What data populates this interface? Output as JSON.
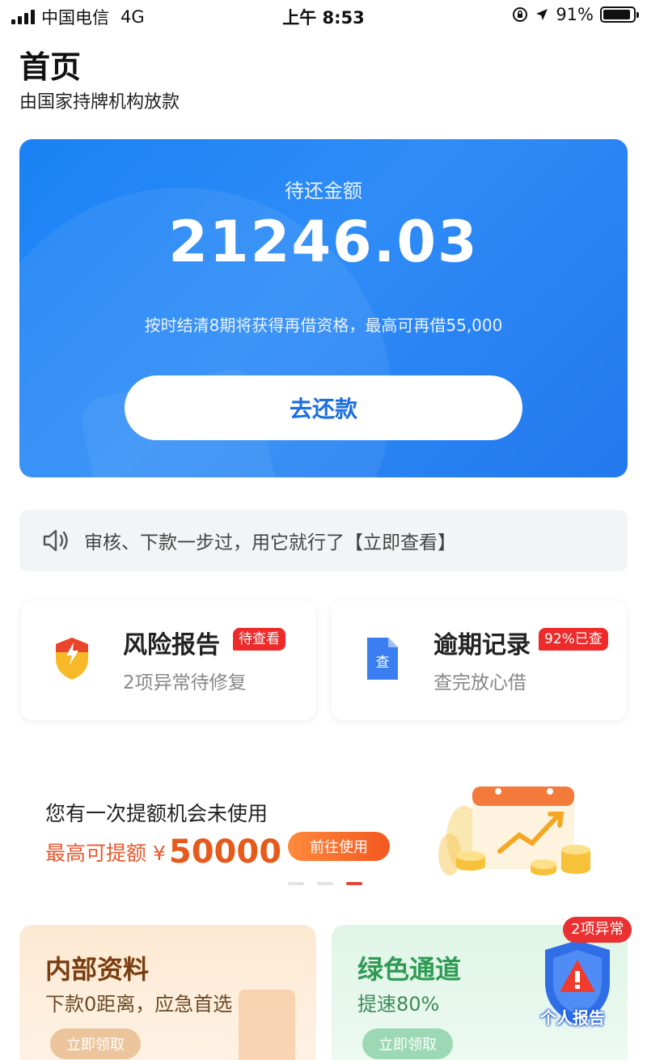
{
  "status_bar": {
    "carrier": "中国电信",
    "network": "4G",
    "time": "上午 8:53",
    "battery": "91%",
    "battery_level": 0.91
  },
  "header": {
    "title": "首页",
    "subtitle": "由国家持牌机构放款"
  },
  "repay_card": {
    "label": "待还金额",
    "amount": "21246.03",
    "note": "按时结清8期将获得再借资格，最高可再借55,000",
    "button": "去还款"
  },
  "notice": {
    "text": "审核、下款一步过，用它就行了【立即查看】",
    "icon": "speaker-icon"
  },
  "features": [
    {
      "title": "风险报告",
      "badge": "待查看",
      "subtitle": "2项异常待修复",
      "icon": "shield-lightning-icon"
    },
    {
      "title": "逾期记录",
      "badge": "92%已查",
      "subtitle": "查完放心借",
      "icon": "document-check-icon"
    }
  ],
  "promo": {
    "title": "您有一次提额机会未使用",
    "prefix": "最高可提额 ¥",
    "amount": "50000",
    "button": "前往使用",
    "icon": "calendar-growth-icon",
    "page_count": 3,
    "active_page": 3
  },
  "bottom_cards": [
    {
      "title": "内部资料",
      "subtitle": "下款0距离，应急首选",
      "button": "立即领取"
    },
    {
      "title": "绿色通道",
      "subtitle": "提速80%",
      "button": "立即领取"
    }
  ],
  "personal_report": {
    "badge": "2项异常",
    "label": "个人报告",
    "icon": "warning-shield-icon"
  },
  "colors": {
    "primary_blue": "#1a82f5",
    "accent_red": "#ee2a2a",
    "promo_orange": "#e65a1c",
    "green": "#2f9b55"
  }
}
